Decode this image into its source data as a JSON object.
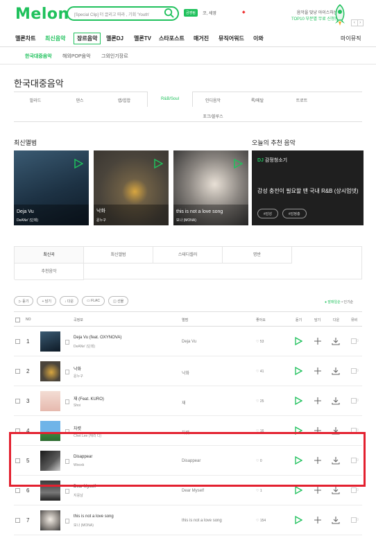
{
  "header": {
    "logo": "Melon",
    "search_placeholder": "[Special Clip] 더 끌리고 따라 , 기회 'Youth'",
    "tag": "금영림",
    "user": "코, 세영",
    "ad_red": "◆",
    "promo_line1": "음악을 맞냥 아이스하는!",
    "promo_line2": "TOP10 부분별 무료 신청중",
    "prev": "‹",
    "next": "›"
  },
  "gnb": [
    "멜론차트",
    "최신음악",
    "장르음악",
    "멜론DJ",
    "멜론TV",
    "스타포스트",
    "매거진",
    "뮤직어워드",
    "이와",
    "마이뮤직"
  ],
  "sub_nav": [
    "한국대중음악",
    "해외POP음악",
    "그외인기장르"
  ],
  "page_title": "한국대중음악",
  "genres_row1": [
    "발라드",
    "댄스",
    "랩/힙합",
    "R&B/Soul",
    "인디음악",
    "록/메탈",
    "트로트"
  ],
  "genres_row2": [
    "포크/블루스"
  ],
  "latest_albums_title": "최신앨범",
  "albums": [
    {
      "title": "Deja Vu",
      "artist": "DeANe' (딘데)"
    },
    {
      "title": "낙화",
      "artist": "윤누구"
    },
    {
      "title": "this is not a love song",
      "artist": "모나 (MONA)"
    }
  ],
  "recommend_title": "오늘의 추천 음악",
  "recommend": {
    "dj": "DJ",
    "head": "감정청소기",
    "body": "감성 충전이 필요할 땐 국내 R&B (상시업뎃)",
    "tags": [
      "#감성",
      "#감정충"
    ]
  },
  "tabs": [
    "최신곡",
    "최신앨범",
    "스테디셀러",
    "명반",
    "추천음악"
  ],
  "actions": [
    "▷ 듣기",
    "+ 담기",
    "↓ 다운",
    "▭ FLAC",
    "◫ 선물"
  ],
  "sort": {
    "active": "● 발매일순",
    "other": "• 인기순"
  },
  "table_headers": {
    "no": "NO",
    "song": "곡정보",
    "album": "앨범",
    "like": "좋아요",
    "listen": "듣기",
    "add": "담기",
    "down": "다운",
    "mv": "뮤비"
  },
  "songs": [
    {
      "no": "1",
      "title": "Deja Vu (feat. OXYNOVA)",
      "artist": "DeANe' (딘데)",
      "album": "Deja Vu",
      "likes": "♡ 53",
      "mv": "0"
    },
    {
      "no": "2",
      "title": "낙화",
      "artist": "윤누구",
      "album": "낙화",
      "likes": "♡ 41",
      "mv": "0"
    },
    {
      "no": "3",
      "title": "재 (Feat. KURO)",
      "artist": "Shoi",
      "album": "재",
      "likes": "♡ 25",
      "mv": "0"
    },
    {
      "no": "4",
      "title": "차렷",
      "artist": "Chet Lee (체리 디)",
      "album": "차렷",
      "likes": "♡ 16",
      "mv": "0"
    },
    {
      "no": "5",
      "title": "Disappear",
      "artist": "Wooxk",
      "album": "Disappear",
      "likes": "♡ 0",
      "mv": "0"
    },
    {
      "no": "6",
      "title": "Dear Myself",
      "artist": "지웅남",
      "album": "Dear Myself",
      "likes": "♡ 1",
      "mv": "0"
    },
    {
      "no": "7",
      "title": "this is not a love song",
      "artist": "모나 (MONA)",
      "album": "this is not a love song",
      "likes": "♡ 154",
      "mv": "0"
    }
  ],
  "colors": {
    "accent": "#1fc15c",
    "highlight": "#e3202f"
  }
}
